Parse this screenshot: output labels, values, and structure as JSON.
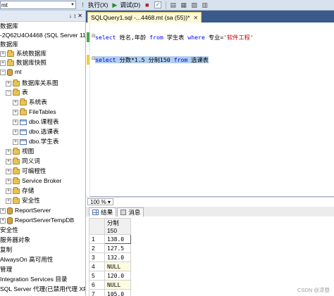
{
  "toolbar": {
    "db_combo": "mt",
    "execute_label": "执行(X)",
    "debug_label": "调试(D)"
  },
  "explorer": {
    "header_pin": "↓ ↕ ✕",
    "items": [
      {
        "label": "数据库"
      },
      {
        "label": "-2Q62U4O4468 (SQL Server 11"
      },
      {
        "label": "数据库"
      },
      {
        "label": "系统数据库"
      },
      {
        "label": "数据库快照"
      },
      {
        "label": "mt"
      },
      {
        "label": "数据库关系图"
      },
      {
        "label": "表"
      },
      {
        "label": "系统表"
      },
      {
        "label": "FileTables"
      },
      {
        "label": "dbo.课程表"
      },
      {
        "label": "dbo.选课表"
      },
      {
        "label": "dbo.学生表"
      },
      {
        "label": "视图"
      },
      {
        "label": "同义词"
      },
      {
        "label": "可编程性"
      },
      {
        "label": "Service Broker"
      },
      {
        "label": "存储"
      },
      {
        "label": "安全性"
      },
      {
        "label": "ReportServer"
      },
      {
        "label": "ReportServerTempDB"
      },
      {
        "label": "安全性"
      },
      {
        "label": "服务器对象"
      },
      {
        "label": "复制"
      },
      {
        "label": "AlwaysOn 高可用性"
      },
      {
        "label": "管理"
      },
      {
        "label": "Integration Services 目录"
      },
      {
        "label": "SQL Server 代理(已禁用代理 XP)"
      }
    ]
  },
  "editor": {
    "tab_title": "SQLQuery1.sql -...4468.mt (sa (55))*",
    "tab_close": "✕",
    "line1": {
      "kw1": "select",
      "cols": " 姓名,年龄 ",
      "kw2": "from",
      "tbl": " 学生表 ",
      "kw3": "where",
      "cond": " 专业=",
      "str": "'软件工程'"
    },
    "line2": {
      "kw1": "select",
      "expr": " 分数*1.5 分制150 ",
      "kw2": "from",
      "tbl": " 选课表"
    },
    "zoom": "100 %"
  },
  "results": {
    "tab_results": "结果",
    "tab_messages": "消息",
    "column": "分制150",
    "rows": [
      {
        "n": "1",
        "v": "138.0"
      },
      {
        "n": "2",
        "v": "127.5"
      },
      {
        "n": "3",
        "v": "132.0"
      },
      {
        "n": "4",
        "v": "NULL"
      },
      {
        "n": "5",
        "v": "120.0"
      },
      {
        "n": "6",
        "v": "NULL"
      },
      {
        "n": "7",
        "v": "105.0"
      }
    ]
  },
  "watermark": "CSDN @凉昼"
}
